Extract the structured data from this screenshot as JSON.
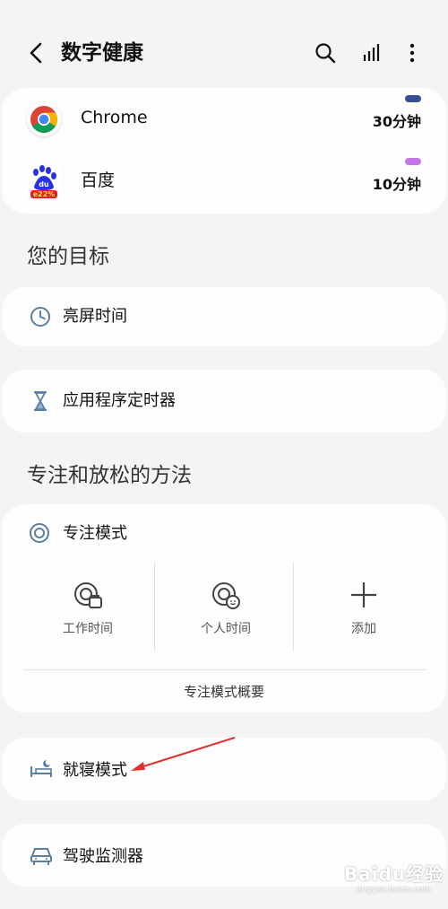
{
  "header": {
    "title": "数字健康"
  },
  "apps": [
    {
      "name": "Chrome",
      "usage": "30分钟",
      "color": "#3a4f8f"
    },
    {
      "name": "百度",
      "usage": "10分钟",
      "color": "#c477e8"
    }
  ],
  "goals": {
    "title": "您的目标",
    "screen_time": "亮屏时间",
    "app_timer": "应用程序定时器"
  },
  "focus": {
    "section_title": "专注和放松的方法",
    "mode_label": "专注模式",
    "buttons": [
      "工作时间",
      "个人时间",
      "添加"
    ],
    "overview": "专注模式概要"
  },
  "bedtime": {
    "label": "就寝模式"
  },
  "driving": {
    "label": "驾驶监测器"
  },
  "baidu_badge": "e22%",
  "watermark": {
    "text": "Baidu经验",
    "sub": "jingyan.baidu.com"
  },
  "annotation": {
    "color": "#e03030"
  }
}
